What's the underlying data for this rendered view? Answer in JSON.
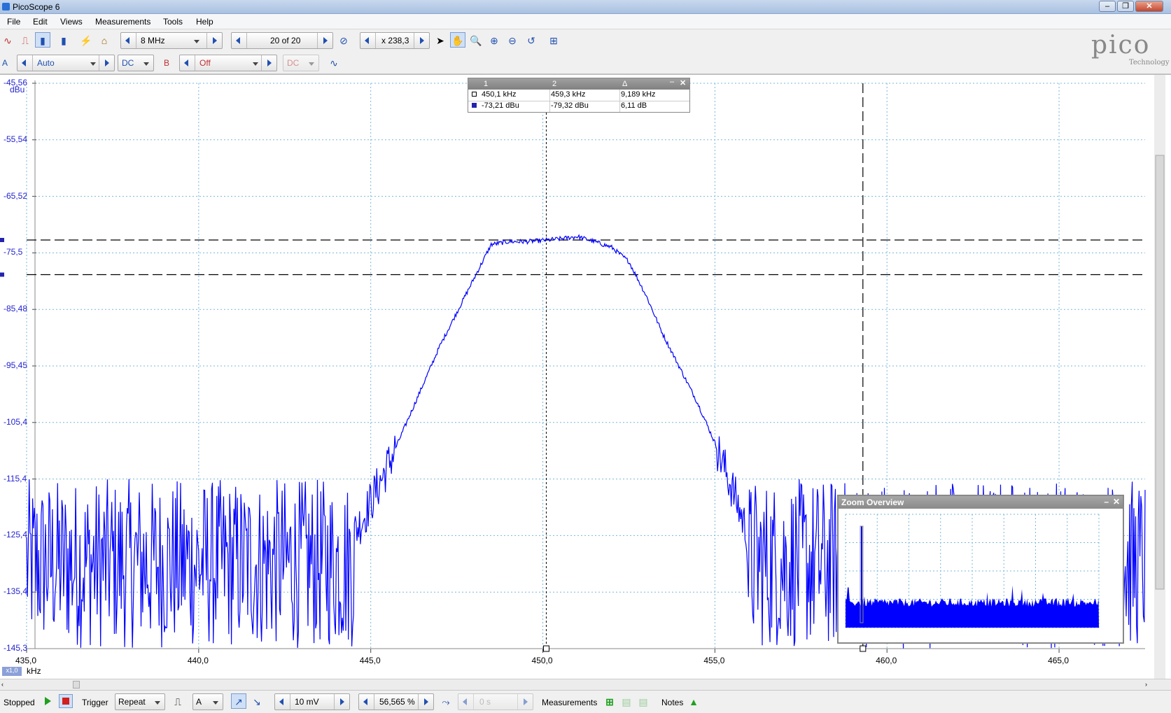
{
  "window": {
    "title": "PicoScope 6",
    "minimize_icon": "minimize-icon",
    "maximize_icon": "restore-icon",
    "close_icon": "close-icon"
  },
  "menu": [
    "File",
    "Edit",
    "Views",
    "Measurements",
    "Tools",
    "Help"
  ],
  "toolbar1": {
    "sample_rate": "8 MHz",
    "buffer": "20 of 20",
    "zoom": "x 238,3"
  },
  "toolbar2": {
    "channel_a_label": "A",
    "channel_a_range": "Auto",
    "channel_a_coupling": "DC",
    "channel_b_label": "B",
    "channel_b_range": "Off",
    "channel_b_coupling": "DC"
  },
  "logo": {
    "word": "pico",
    "sub": "Technology"
  },
  "y_axis": {
    "unit": "dBu",
    "ticks": [
      "-45,56",
      "-55,54",
      "-65,52",
      "-75,5",
      "-85,48",
      "-95,45",
      "-105,4",
      "-115,4",
      "-125,4",
      "-135,4",
      "-145,3"
    ]
  },
  "x_axis": {
    "unit": "kHz",
    "scale": "x1,0",
    "ticks": [
      "435,0",
      "440,0",
      "445,0",
      "450,0",
      "455,0",
      "460,0",
      "465,0"
    ]
  },
  "cursor_table": {
    "headers": [
      "1",
      "2",
      "Δ"
    ],
    "rows": [
      [
        "450,1 kHz",
        "459,3 kHz",
        "9,189 kHz"
      ],
      [
        "-73,21 dBu",
        "-79,32 dBu",
        "6,11 dB"
      ]
    ]
  },
  "zoom_overview": {
    "title": "Zoom Overview"
  },
  "status": {
    "state": "Stopped",
    "trigger_label": "Trigger",
    "trigger_mode": "Repeat",
    "trigger_channel": "A",
    "threshold": "10 mV",
    "pretrigger": "56,565 %",
    "delay": "0 s",
    "measurements_label": "Measurements",
    "notes_label": "Notes"
  },
  "colors": {
    "trace": "#0000ff",
    "grid": "#7ab8d8",
    "accent": "#2050b0"
  },
  "chart_data": {
    "type": "line",
    "xlabel": "kHz",
    "ylabel": "dBu",
    "xlim": [
      435.0,
      467.5
    ],
    "ylim": [
      -145.3,
      -45.56
    ],
    "series": [
      {
        "values_desc": "spectrum",
        "x": [
          435.0,
          436.0,
          437.0,
          438.0,
          439.0,
          440.0,
          441.0,
          442.0,
          443.0,
          444.0,
          444.8,
          445.5,
          446.0,
          446.5,
          447.0,
          447.5,
          448.0,
          448.5,
          449.0,
          449.5,
          450.0,
          450.5,
          451.0,
          451.5,
          452.0,
          452.5,
          453.0,
          453.5,
          454.0,
          454.5,
          455.0,
          455.5,
          456.0,
          457.0,
          458.0,
          459.0,
          460.0,
          462.0,
          464.0,
          466.0,
          467.0
        ],
        "y": [
          -130,
          -130,
          -130,
          -130,
          -130,
          -130,
          -130,
          -130,
          -130,
          -130,
          -122,
          -113,
          -106,
          -99,
          -92,
          -86,
          -80,
          -74,
          -73.5,
          -73.5,
          -73.3,
          -73,
          -72.6,
          -73.5,
          -74.5,
          -77,
          -83,
          -90,
          -96,
          -102,
          -109,
          -117,
          -126,
          -130,
          -130,
          -130,
          -130,
          -130,
          -130,
          -130,
          -130
        ]
      }
    ],
    "cursors": {
      "x1": 450.1,
      "x2": 459.3,
      "y1": -73.21,
      "y2": -79.32
    }
  }
}
